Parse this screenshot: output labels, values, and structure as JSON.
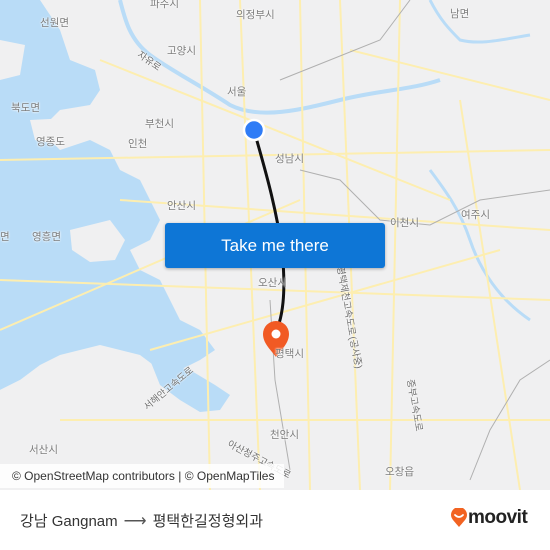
{
  "map": {
    "place_labels": [
      {
        "name": "파주시"
      },
      {
        "name": "의정부시"
      },
      {
        "name": "남면"
      },
      {
        "name": "선원면"
      },
      {
        "name": "고양시"
      },
      {
        "name": "서울"
      },
      {
        "name": "북도면"
      },
      {
        "name": "부천시"
      },
      {
        "name": "영종도"
      },
      {
        "name": "인천"
      },
      {
        "name": "성남시"
      },
      {
        "name": "안산시"
      },
      {
        "name": "이천시"
      },
      {
        "name": "여주시"
      },
      {
        "name": "면"
      },
      {
        "name": "영흥면"
      },
      {
        "name": "오산시"
      },
      {
        "name": "평택시"
      },
      {
        "name": "천안시"
      },
      {
        "name": "서산시"
      },
      {
        "name": "오창읍"
      }
    ],
    "road_labels": [
      {
        "name": "자유로"
      },
      {
        "name": "서해안고속도로"
      },
      {
        "name": "평택제천고속도로"
      },
      {
        "name": "(공사중)"
      },
      {
        "name": "중부고속도로"
      },
      {
        "name": "아산청주고속도로"
      }
    ],
    "origin_marker": {
      "label": "강남 Gangnam",
      "color": "#2f7cf6"
    },
    "destination_marker": {
      "label": "평택한길정형외과",
      "color": "#f15a24"
    },
    "route_color": "#111111"
  },
  "cta": {
    "label": "Take me there",
    "color": "#0e76d6"
  },
  "attribution": "© OpenStreetMap contributors | © OpenMapTiles",
  "footer": {
    "origin": "강남 Gangnam",
    "arrow": "⟶",
    "destination": "평택한길정형외과",
    "brand": "moovit",
    "brand_color": "#f26322"
  }
}
